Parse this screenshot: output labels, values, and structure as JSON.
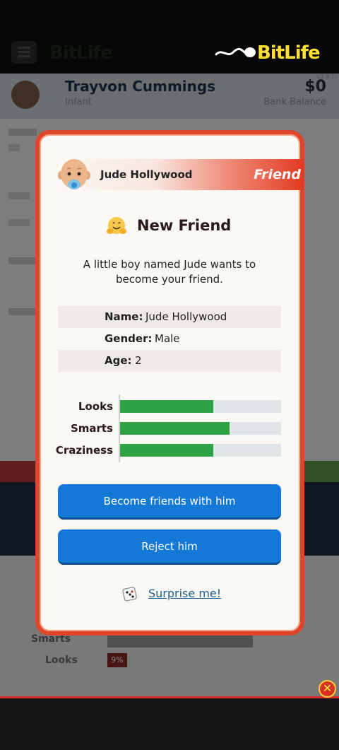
{
  "app": {
    "brand": "BitLife",
    "version": "v3.9.7c"
  },
  "profile": {
    "name": "Trayvon Cummings",
    "role": "Infant",
    "balance": "$0",
    "balance_label": "Bank Balance"
  },
  "background_stats": {
    "looks_label": "Looks",
    "smarts_label": "Smarts",
    "looks_pct": "9%"
  },
  "modal": {
    "banner": {
      "name": "Jude Hollywood",
      "tag": "Friend"
    },
    "title": "New Friend",
    "description": "A little boy named Jude wants to become your friend.",
    "info": [
      {
        "key": "Name:",
        "value": "Jude Hollywood"
      },
      {
        "key": "Gender:",
        "value": "Male"
      },
      {
        "key": "Age:",
        "value": "2"
      }
    ],
    "attributes": [
      {
        "label": "Looks",
        "level": 0.58
      },
      {
        "label": "Smarts",
        "level": 0.68
      },
      {
        "label": "Craziness",
        "level": 0.58
      }
    ],
    "buttons": {
      "accept": "Become friends with him",
      "reject": "Reject him",
      "surprise": "Surprise me!"
    },
    "colors": {
      "frame": "#e0442b",
      "button": "#1378d6",
      "bar_fill": "#2ea344",
      "bar_track": "#e2e5e8"
    }
  },
  "icons": {
    "hug": "hugging-face-icon",
    "dice": "dice-icon",
    "close": "close-icon"
  }
}
